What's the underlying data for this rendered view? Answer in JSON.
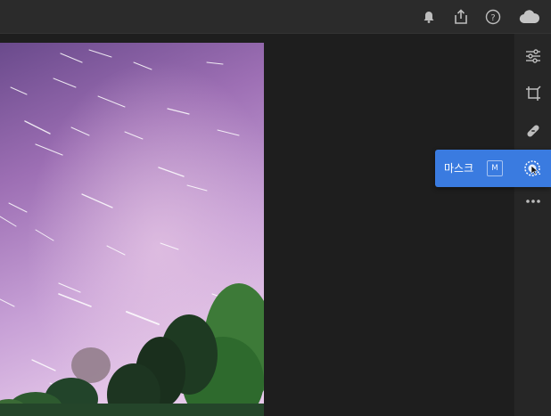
{
  "topbar": {
    "icons": [
      "bell-icon",
      "share-icon",
      "help-icon",
      "cloud-icon"
    ]
  },
  "rightbar": {
    "icons": [
      "edit-sliders-icon",
      "crop-icon",
      "healing-bandage-icon",
      "mask-icon",
      "more-icon"
    ]
  },
  "tooltip": {
    "label": "마스크",
    "shortcut": "M"
  },
  "colors": {
    "accent": "#3a7be0",
    "panel": "#262626",
    "background": "#1e1e1e"
  }
}
